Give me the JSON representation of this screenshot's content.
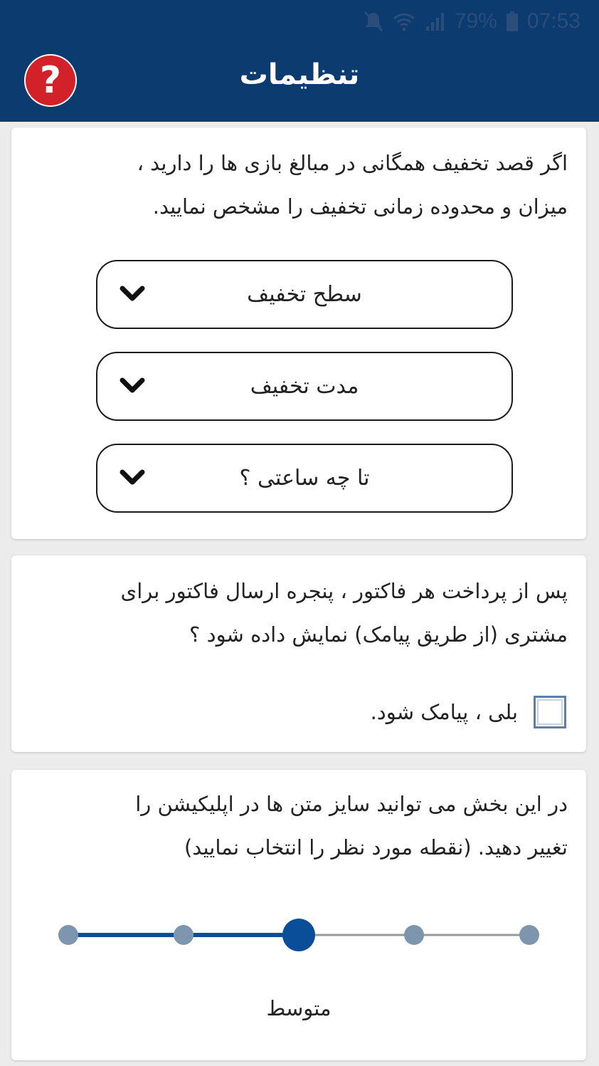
{
  "status_bar": {
    "battery": "79%",
    "time": "07:53"
  },
  "header": {
    "title": "تنظیمات",
    "help_icon": "question-icon",
    "help_color": "#d22128",
    "color": "#0c3b70"
  },
  "discount_card": {
    "line1": "اگر قصد تخفیف همگانی در مبالغ بازی ها را دارید ،",
    "line2": "میزان و محدوده زمانی تخفیف را مشخص نمایید.",
    "dropdowns": [
      {
        "label": "سطح تخفیف",
        "icon": "chevron-down-icon"
      },
      {
        "label": "مدت تخفیف",
        "icon": "chevron-down-icon"
      },
      {
        "label": "تا چه ساعتی ؟",
        "icon": "chevron-down-icon"
      }
    ]
  },
  "invoice_card": {
    "line1": "پس از پرداخت هر فاکتور ، پنجره ارسال فاکتور برای",
    "line2": "مشتری (از طریق پیامک) نمایش داده شود ؟",
    "checkbox_label": "بلی ، پیامک شود.",
    "checked": false
  },
  "text_size_card": {
    "line1": "در این بخش می توانید سایز متن ها در اپلیکیشن را",
    "line2": "تغییر دهید. (نقطه مورد نظر را انتخاب نمایید)",
    "levels": 5,
    "selected_index": 2,
    "selected_label": "متوسط",
    "active_color": "#0a4e9a",
    "inactive_color": "#7d95ad"
  }
}
